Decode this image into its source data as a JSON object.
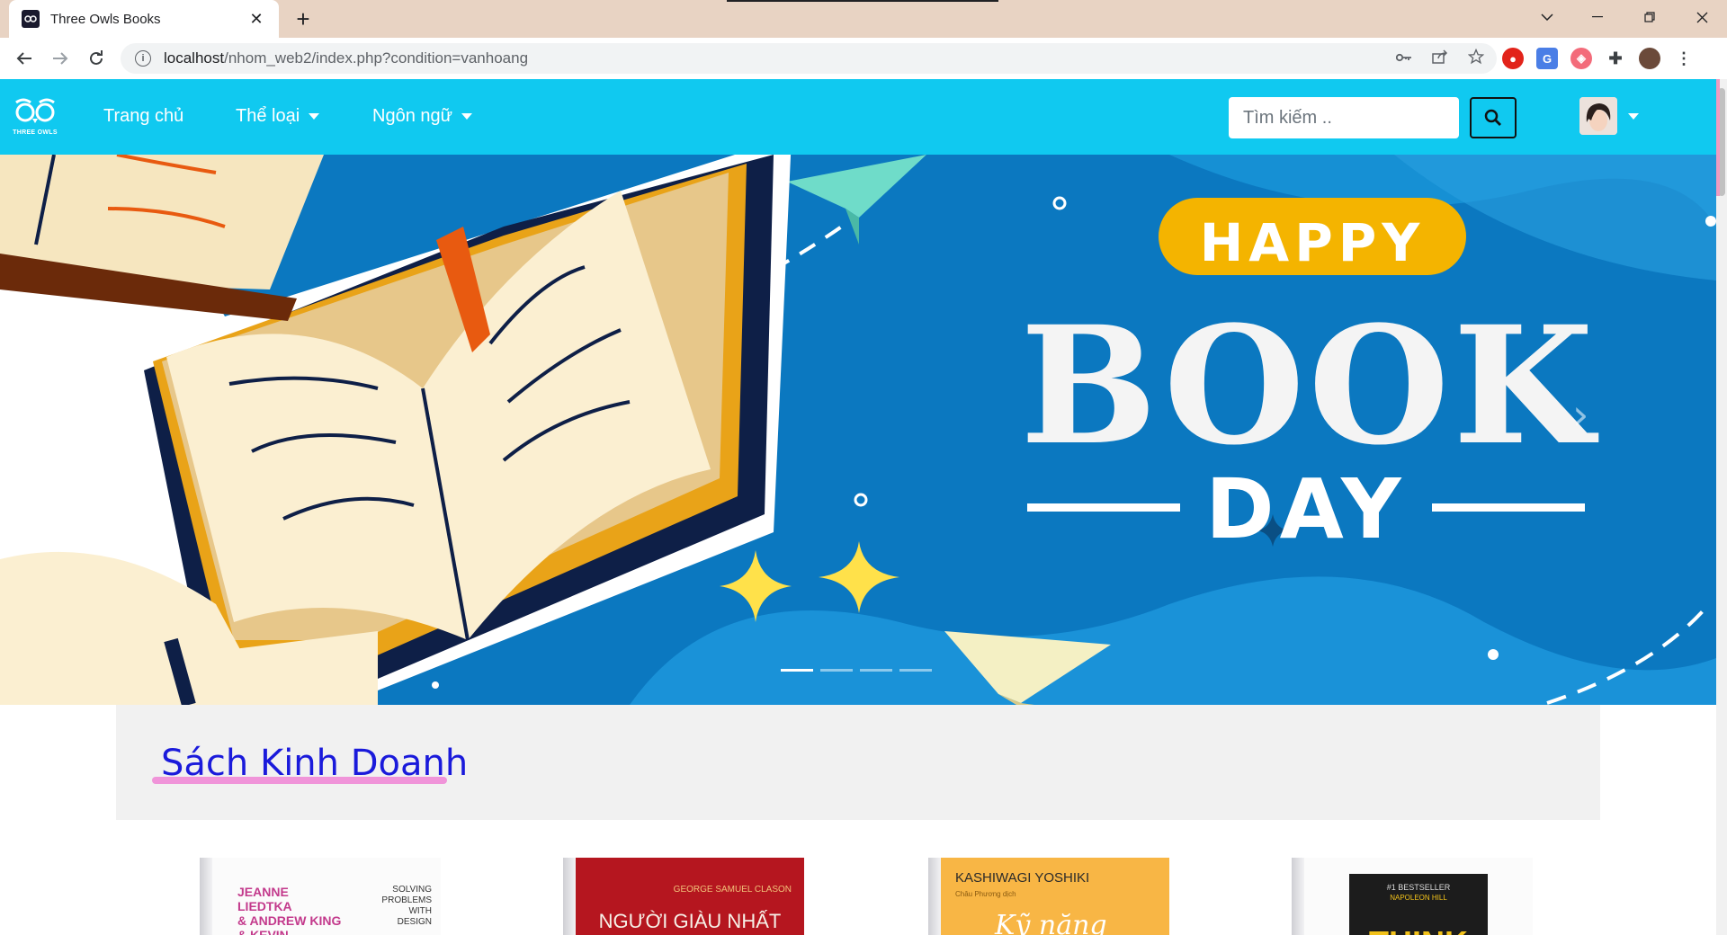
{
  "browser": {
    "tab_title": "Three Owls Books",
    "new_tab": "+",
    "close": "✕",
    "url_host": "localhost",
    "url_path": "/nhom_web2/index.php?condition=vanhoang"
  },
  "navbar": {
    "logo_text": "THREE OWLS",
    "items": [
      {
        "label": "Trang chủ",
        "dropdown": false
      },
      {
        "label": "Thể loại",
        "dropdown": true
      },
      {
        "label": "Ngôn ngữ",
        "dropdown": true
      }
    ],
    "search_placeholder": "Tìm kiếm .."
  },
  "carousel": {
    "banner_line1": "HAPPY",
    "banner_line2": "BOOK",
    "banner_line3": "DAY",
    "slides_count": 4,
    "active_slide": 0,
    "prev": "‹",
    "next": "›"
  },
  "section": {
    "title": "Sách Kinh Doanh"
  },
  "books": [
    {
      "author": "JEANNE LIEDTKA\n& ANDREW KING\n& KEVIN BENNETT",
      "subtitle": "SOLVING\nPROBLEMS\nWITH\nDESIGN"
    },
    {
      "author": "GEORGE SAMUEL CLASON",
      "title": "NGƯỜI GIÀU NHẤT"
    },
    {
      "author": "KASHIWAGI YOSHIKI",
      "translator": "Châu Phương dịch",
      "title": "Kỹ năng"
    },
    {
      "badge": "#1 BESTSELLER",
      "author": "NAPOLEON HILL",
      "title": "THINK"
    }
  ],
  "colors": {
    "navbar": "#10c9f0",
    "banner_bg": "#0e7fc6",
    "section_title": "#1a1adb",
    "underline": "#ef8ad6"
  }
}
